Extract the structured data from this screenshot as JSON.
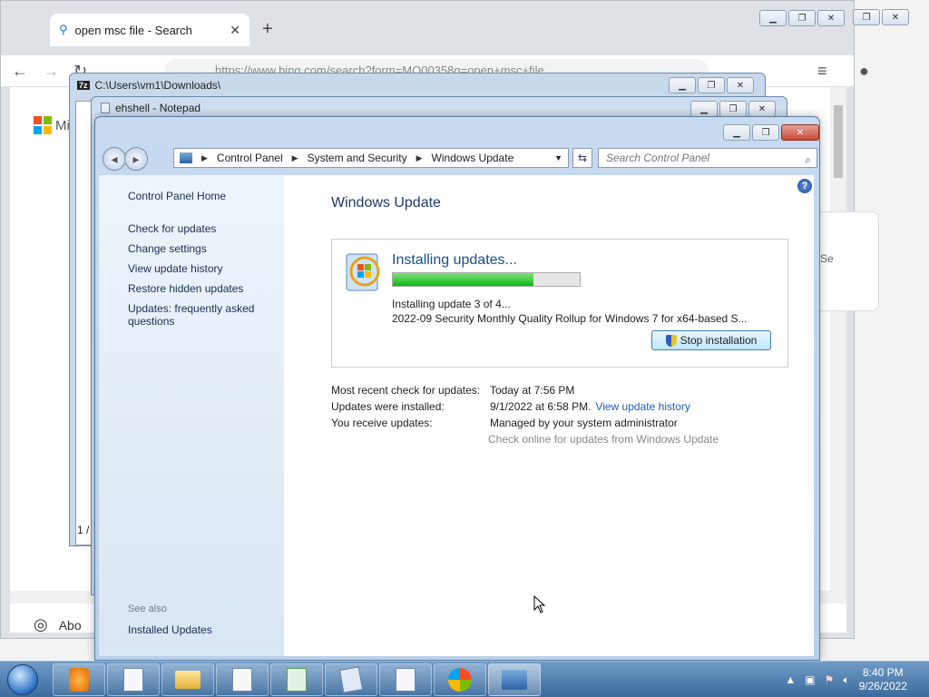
{
  "browser": {
    "tab_title": "open msc file - Search",
    "url": "https://www.bing.com/search?form=MO00358q=open+msc+file",
    "partial_text": "Mi",
    "side_partial": "Se",
    "about": "Abo"
  },
  "zip_window": {
    "title": "C:\\Users\\vm1\\Downloads\\",
    "status": "1 /"
  },
  "notepad_window": {
    "title": "ehshell - Notepad"
  },
  "control_panel": {
    "breadcrumb": [
      "Control Panel",
      "System and Security",
      "Windows Update"
    ],
    "search_placeholder": "Search Control Panel",
    "sidebar": {
      "home": "Control Panel Home",
      "links": [
        "Check for updates",
        "Change settings",
        "View update history",
        "Restore hidden updates",
        "Updates: frequently asked questions"
      ],
      "see_also": "See also",
      "installed_updates": "Installed Updates"
    },
    "heading": "Windows Update",
    "status": {
      "title": "Installing updates...",
      "progress": 0.75,
      "step": "Installing update 3 of 4...",
      "update_name": "2022-09 Security Monthly Quality Rollup for Windows 7 for x64-based S...",
      "stop_button": "Stop installation"
    },
    "info": {
      "recent_check_label": "Most recent check for updates:",
      "recent_check_value": "Today at 7:56 PM",
      "installed_label": "Updates were installed:",
      "installed_value": "9/1/2022 at 6:58 PM.",
      "history_link": "View update history",
      "receive_label": "You receive updates:",
      "receive_value": "Managed by your system administrator",
      "check_online": "Check online for updates from Windows Update"
    }
  },
  "taskbar": {
    "time": "8:40 PM",
    "date": "9/26/2022"
  }
}
